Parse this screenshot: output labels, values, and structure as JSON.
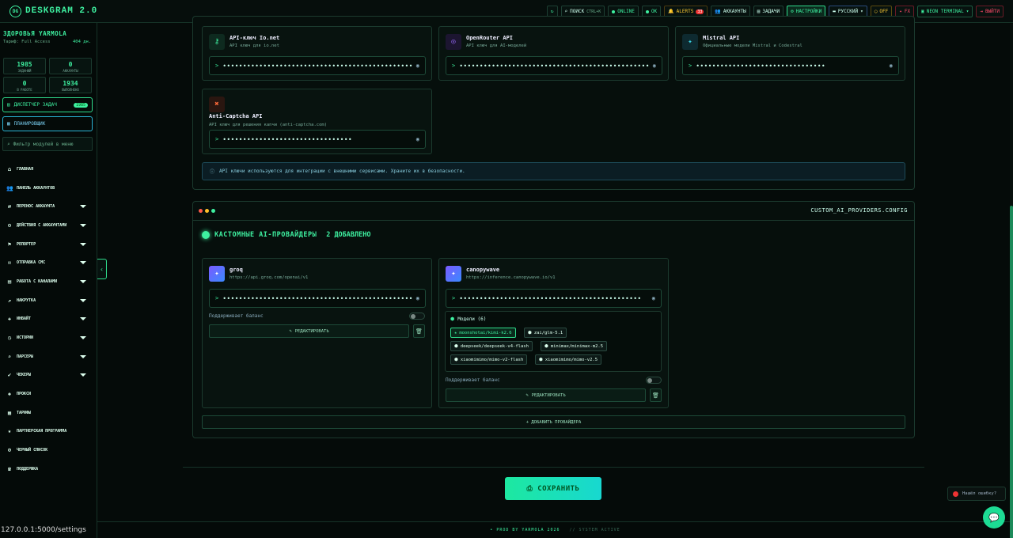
{
  "app": {
    "logo": "DG",
    "title": "DESKGRAM 2.0"
  },
  "topbar": {
    "refresh_icon": "↻",
    "search_label": "ПОИСК",
    "search_kbd": "CTRL+K",
    "online_label": "ONLINE",
    "ok_label": "OK",
    "alerts_label": "ALERTS",
    "alerts_count": "33",
    "accounts_label": "АККАУНТЫ",
    "tasks_label": "ЗАДАЧИ",
    "settings_label": "НАСТРОЙКИ",
    "language_label": "РУССКИЙ",
    "off_label": "OFF",
    "fx_label": "FX",
    "terminal_label": "NEON TERMINAL",
    "logout_label": "ВЫЙТИ"
  },
  "sidebar": {
    "user_name": "ЗДОРОВЬЯ YARMOLA",
    "plan": "Тариф: Full Access",
    "days_left": "404 дн.",
    "stats": [
      {
        "value": "1985",
        "label": "ЗАДАНИЙ"
      },
      {
        "value": "0",
        "label": "АККАУНТЫ"
      },
      {
        "value": "0",
        "label": "В РАБОТЕ"
      },
      {
        "value": "1934",
        "label": "ВЫПОЛНЕНО"
      }
    ],
    "dispatcher_label": "ДИСПЕТЧЕР ЗАДАЧ",
    "dispatcher_count": "1985",
    "scheduler_label": "ПЛАНИРОВЩИК",
    "filter_placeholder": "Фильтр модулей в меню",
    "nav": [
      {
        "label": "ГЛАВНАЯ",
        "icon": "⌂",
        "caret": false
      },
      {
        "label": "ПАНЕЛЬ АККАУНТОВ",
        "icon": "👥",
        "caret": false
      },
      {
        "label": "ПЕРЕНОС АККАУНТА",
        "icon": "⇄",
        "caret": true
      },
      {
        "label": "ДЕЙСТВИЯ С АККАУНТАМИ",
        "icon": "⚙",
        "caret": true
      },
      {
        "label": "РЕПОРТЕР",
        "icon": "⚑",
        "caret": true
      },
      {
        "label": "ОТПРАВКА СМС",
        "icon": "✉",
        "caret": true
      },
      {
        "label": "РАБОТА С КАНАЛАМИ",
        "icon": "▤",
        "caret": true
      },
      {
        "label": "НАКРУТКА",
        "icon": "↗",
        "caret": true
      },
      {
        "label": "ИНВАЙТ",
        "icon": "✚",
        "caret": true
      },
      {
        "label": "ИСТОРИИ",
        "icon": "◷",
        "caret": true
      },
      {
        "label": "ПАРСЕРЫ",
        "icon": "⌕",
        "caret": true
      },
      {
        "label": "ЧЕКЕРЫ",
        "icon": "✔",
        "caret": true
      },
      {
        "label": "ПРОКСИ",
        "icon": "◈",
        "caret": false
      },
      {
        "label": "ТАРИФЫ",
        "icon": "▦",
        "caret": false
      },
      {
        "label": "ПАРТНЕРСКАЯ ПРОГРАММА",
        "icon": "★",
        "caret": false
      },
      {
        "label": "ЧЕРНЫЙ СПИСОК",
        "icon": "⊘",
        "caret": false
      },
      {
        "label": "ПОДДЕРЖКА",
        "icon": "☎",
        "caret": false
      }
    ]
  },
  "status_url": "127.0.0.1:5000/settings",
  "api_cards": [
    {
      "title": "API-ключ Io.net",
      "desc": "API ключ для io.net",
      "icon": "⚷",
      "icon_color": "#3ef0a0",
      "icon_bg": "#0e2a1f",
      "masked": "••••••••••••••••••••••••••••••••••••••••••••••••••••••••••••"
    },
    {
      "title": "OpenRouter API",
      "desc": "API ключ для AI-моделей",
      "icon": "◎",
      "icon_color": "#9a6bff",
      "icon_bg": "#1c1530",
      "masked": "••••••••••••••••••••••••••••••••••••••••••••••••••••••••••••••"
    },
    {
      "title": "Mistral API",
      "desc": "Официальные модели Mistral и Codestral",
      "icon": "✦",
      "icon_color": "#3ad6e6",
      "icon_bg": "#0e2a30",
      "masked": "••••••••••••••••••••••••••••••••"
    },
    {
      "title": "Anti-Captcha API",
      "desc": "API ключ для решения капчи (anti-captcha.com)",
      "icon": "✖",
      "icon_color": "#ff6a3a",
      "icon_bg": "#2a1610",
      "masked": "••••••••••••••••••••••••••••••••"
    }
  ],
  "info_text": "API ключи используются для интеграции с внешними сервисами. Храните их в безопасности.",
  "custom": {
    "terminal_title": "CUSTOM_AI_PROVIDERS.CONFIG",
    "heading": "КАСТОМНЫЕ AI-ПРОВАЙДЕРЫ",
    "count_label": "2 ДОБАВЛЕНО",
    "balance_label": "Поддерживает баланс",
    "edit_label": "РЕДАКТИРОВАТЬ",
    "add_label": "+ ДОБАВИТЬ ПРОВАЙДЕРА",
    "providers": [
      {
        "name": "groq",
        "url": "https://api.groq.com/openai/v1",
        "masked": "•••••••••••••••••••••••••••••••••••••••••••••••••••••••••••"
      },
      {
        "name": "canopywave",
        "url": "https://inference.canopywave.io/v1",
        "masked": "•••••••••••••••••••••••••••••••••••••••••••••"
      }
    ],
    "models_label": "Модели (6)",
    "models": [
      {
        "name": "moonshotai/kimi-k2.6",
        "active": true
      },
      {
        "name": "zai/glm-5.1",
        "active": false
      },
      {
        "name": "deepseek/deepseek-v4-flash",
        "active": false
      },
      {
        "name": "minimax/minimax-m2.5",
        "active": false
      },
      {
        "name": "xiaomimimo/mimo-v2-flash",
        "active": false
      },
      {
        "name": "xiaomimimo/mimo-v2.5",
        "active": false
      }
    ]
  },
  "save_label": "СОХРАНИТЬ",
  "footer": {
    "left": "• PROD BY YARMOLA 2026",
    "right": "// SYSTEM ACTIVE"
  },
  "bug_label": "Нашёл ошибку?",
  "chat_icon": "💬"
}
